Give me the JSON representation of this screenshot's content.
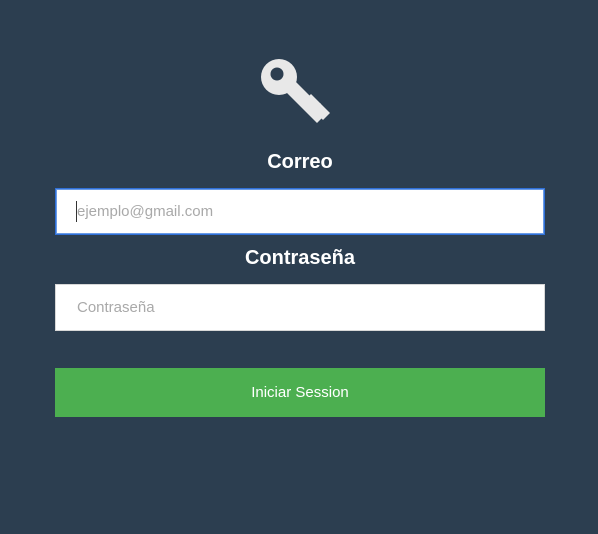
{
  "logo": {
    "icon": "key-icon",
    "color": "#e8e8e8"
  },
  "email": {
    "label": "Correo",
    "placeholder": "ejemplo@gmail.com",
    "value": ""
  },
  "password": {
    "label": "Contraseña",
    "placeholder": "Contraseña",
    "value": ""
  },
  "submit": {
    "label": "Iniciar Session"
  },
  "colors": {
    "background": "#2c3e50",
    "button": "#4caf50",
    "focus_border": "#2f6fd6"
  }
}
